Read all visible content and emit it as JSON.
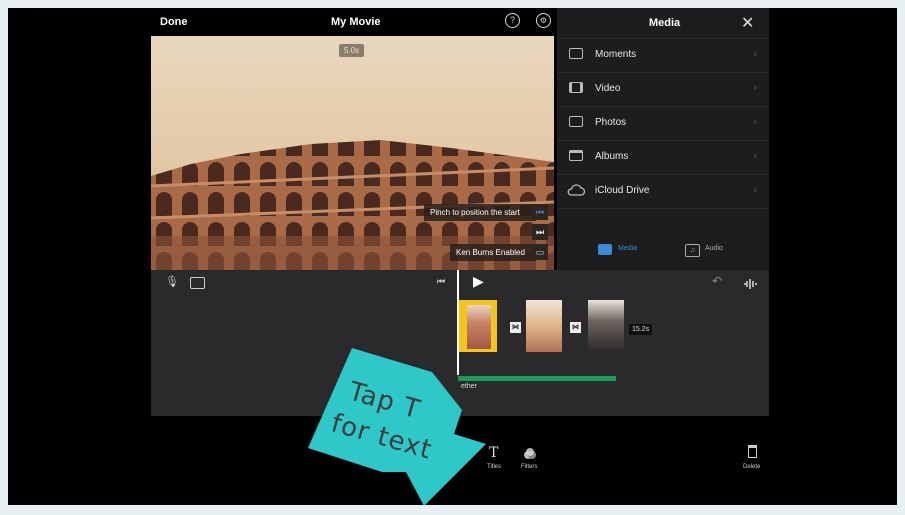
{
  "topbar": {
    "done_label": "Done",
    "title": "My Movie"
  },
  "preview": {
    "duration_badge": "5.0s",
    "pinch_tip": "Pinch to position the start",
    "ken_burns_label": "Ken Burns Enabled"
  },
  "media_panel": {
    "title": "Media",
    "items": [
      {
        "label": "Moments",
        "icon": "moments-icon"
      },
      {
        "label": "Video",
        "icon": "film-icon"
      },
      {
        "label": "Photos",
        "icon": "photo-icon"
      },
      {
        "label": "Albums",
        "icon": "album-icon"
      },
      {
        "label": "iCloud Drive",
        "icon": "cloud-icon"
      }
    ],
    "tabs": {
      "media": "Media",
      "audio": "Audio"
    }
  },
  "timeline": {
    "total_duration": "15.2s",
    "title_overlay_fragment": "ether"
  },
  "toolbar": {
    "titles_label": "Titles",
    "filters_label": "Filters",
    "delete_label": "Delete"
  },
  "annotation": {
    "line1": "Tap T",
    "line2": "for text"
  },
  "colors": {
    "accent_blue": "#3b8bd8",
    "clip_selected": "#f5c518",
    "audio_green": "#1e9a5a",
    "arrow_teal": "#2ec8c8"
  }
}
